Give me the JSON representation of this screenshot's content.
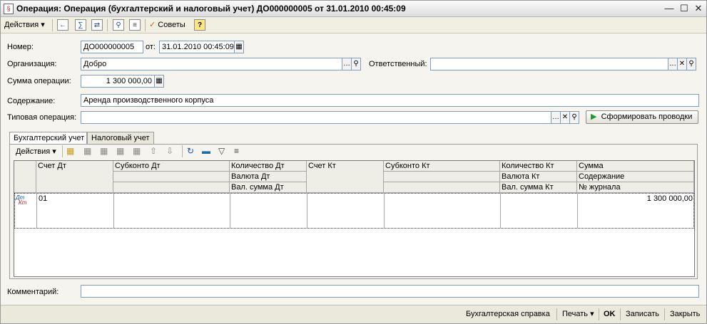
{
  "window": {
    "title": "Операция: Операция (бухгалтерский и налоговый учет) ДО000000005 от 31.01.2010 00:45:09"
  },
  "toolbar": {
    "actions_label": "Действия",
    "tips_label": "Советы"
  },
  "form": {
    "number_label": "Номер:",
    "number_value": "ДО000000005",
    "from_label": "от:",
    "date_value": "31.01.2010 00:45:09",
    "org_label": "Организация:",
    "org_value": "Добро",
    "responsible_label": "Ответственный:",
    "responsible_value": "",
    "sum_label": "Сумма операции:",
    "sum_value": "1 300 000,00",
    "content_label": "Содержание:",
    "content_value": "Аренда производственного корпуса",
    "typical_label": "Типовая операция:",
    "typical_value": "",
    "generate_button": "Сформировать проводки",
    "comment_label": "Комментарий:",
    "comment_value": ""
  },
  "tabs": [
    {
      "label": "Бухгалтерский учет",
      "active": true
    },
    {
      "label": "Налоговый учет",
      "active": false
    }
  ],
  "table_toolbar": {
    "actions_label": "Действия"
  },
  "table": {
    "headers": {
      "schet_dt": "Счет Дт",
      "subkonto_dt": "Субконто Дт",
      "kol_dt": "Количество Дт",
      "valuta_dt": "Валюта Дт",
      "valsum_dt": "Вал. сумма Дт",
      "schet_kt": "Счет Кт",
      "subkonto_kt": "Субконто Кт",
      "kol_kt": "Количество Кт",
      "valuta_kt": "Валюта Кт",
      "valsum_kt": "Вал. сумма Кт",
      "summa": "Сумма",
      "soderzhanie": "Содержание",
      "journal": "№ журнала"
    },
    "rows": [
      {
        "icon_dt": "Дт",
        "icon_kt": "Кт",
        "schet_dt": "01",
        "summa": "1 300 000,00"
      }
    ]
  },
  "footer": {
    "reference": "Бухгалтерская справка",
    "print": "Печать",
    "ok": "OK",
    "save": "Записать",
    "close": "Закрыть"
  },
  "icons": [
    "document-icon",
    "minimize-icon",
    "maximize-icon",
    "close-icon",
    "back-icon",
    "post-icon",
    "structure-icon",
    "preview-icon",
    "report-icon",
    "tips-icon",
    "help-icon",
    "calendar-icon",
    "ellipsis-icon",
    "search-icon",
    "clear-icon",
    "play-icon",
    "dropdown-icon"
  ]
}
